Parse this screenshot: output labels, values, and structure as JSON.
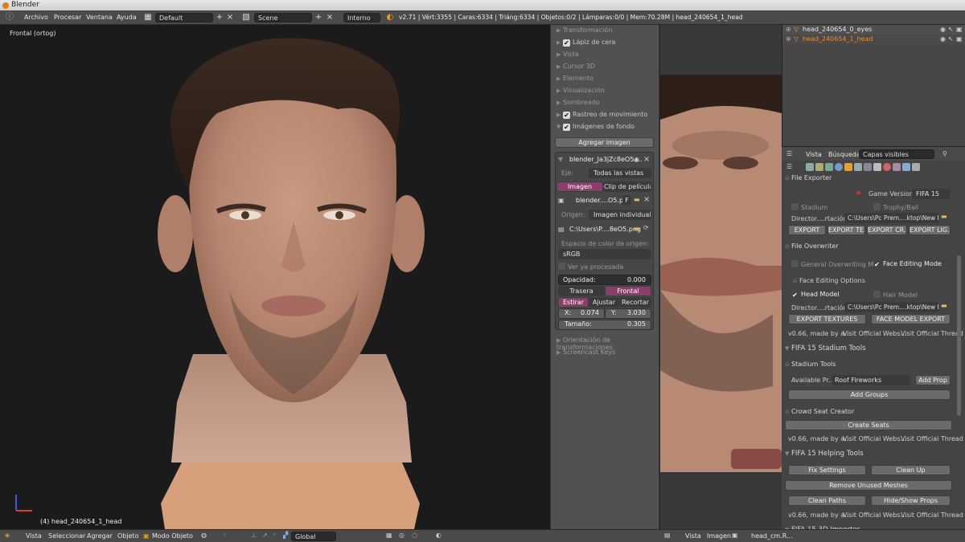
{
  "window": {
    "title": "Blender"
  },
  "menubar": {
    "items": [
      "Archivo",
      "Procesar",
      "Ventana",
      "Ayuda"
    ],
    "layout": "Default",
    "scene": "Scene",
    "engine": "Interno",
    "stats": "v2.71 | Vért:3355 | Caras:6334 | Triáng:6334 | Objetos:0/2 | Lámparas:0/0 | Mem:70.28M | head_240654_1_head"
  },
  "viewport": {
    "view_label": "Frontal (ortog)",
    "object_label": "(4) head_240654_1_head"
  },
  "npanel": {
    "sections": [
      {
        "label": "Transformación",
        "checkbox": false
      },
      {
        "label": "Lápiz de cera",
        "checkbox": true
      },
      {
        "label": "Vista",
        "checkbox": false
      },
      {
        "label": "Cursor 3D",
        "checkbox": false
      },
      {
        "label": "Elemento",
        "checkbox": false
      },
      {
        "label": "Visualización",
        "checkbox": false
      },
      {
        "label": "Sombreado",
        "checkbox": false
      },
      {
        "label": "Rastreo de movimiento",
        "checkbox": true
      },
      {
        "label": "Imágenes de fondo",
        "checkbox": true
      }
    ],
    "add_image": "Agregar imagen",
    "bg_name": "blender_Ja3jZc8eO5....",
    "axis_label": "Eje:",
    "axis_value": "Todas las vistas",
    "tab_image": "Imagen",
    "tab_clip": "Clip de película",
    "image_file": "blender....O5.png",
    "image_flag": "F",
    "origin_label": "Origen:",
    "origin_value": "Imagen individual",
    "path": "C:\\Users\\P....8eO5.png",
    "colorspace_label": "Espacio de color de origen:",
    "colorspace_value": "sRGB",
    "view_processed": "Ver ya procesada",
    "opacity_label": "Opacidad:",
    "opacity_value": "0.000",
    "back": "Trasera",
    "front": "Frontal",
    "stretch": "Estirar",
    "fit": "Ajustar",
    "crop": "Recortar",
    "x_label": "X:",
    "x_value": "0.074",
    "y_label": "Y:",
    "y_value": "3.030",
    "size_label": "Tamaño:",
    "size_value": "0.305",
    "orient": "Orientación de transformaciones",
    "screencast": "Screencast Keys"
  },
  "outliner": {
    "items": [
      {
        "label": "head_240654_0_eyes",
        "active": false
      },
      {
        "label": "head_240654_1_head",
        "active": true
      }
    ]
  },
  "props_header": {
    "view": "Vista",
    "search": "Búsqueda",
    "layers": "Capas visibles"
  },
  "props": {
    "file_exporter": "File Exporter",
    "game_version_label": "Game Version",
    "game_version": "FIFA 15",
    "stadium": "Stadium",
    "trophy": "Trophy/Ball",
    "dir_label": "Director....rtación:",
    "dir_value": "C:\\Users\\Pc Prem....ktop\\New Folder\\",
    "export": "EXPORT",
    "export_tex": "EXPORT TE...",
    "export_cr": "EXPORT CR...",
    "export_lig": "EXPORT LIG...",
    "file_overwriter": "File Overwriter",
    "general_overwriting": "General Overwriting M...",
    "face_editing_mode": "Face Editing Mode",
    "face_editing_options": "Face Editing Options",
    "head_model": "Head Model",
    "hair_model": "Hair Model",
    "dir2_label": "Director....rtación:",
    "dir2_value": "C:\\Users\\Pc Prem....ktop\\New Folder\\",
    "export_textures": "EXPORT TEXTURES",
    "face_model_export": "FACE MODEL EXPORT",
    "made_by": "v0.66, made by a...",
    "visit_webs": "Visit Official Webs...",
    "visit_thread": "Visit Official Thread",
    "stadium_tools": "FIFA 15 Stadium Tools",
    "stadium_tools_sub": "Stadium Tools",
    "available_label": "Available Pr...",
    "available_value": "Roof Fireworks",
    "add_prop": "Add Prop",
    "add_groups": "Add Groups",
    "crowd": "Crowd Seat Creator",
    "create_seats": "Create Seats",
    "helping_tools": "FIFA 15 Helping Tools",
    "fix_settings": "Fix Settings",
    "clean_up": "Clean Up",
    "remove_unused": "Remove Unused Meshes",
    "clean_paths": "Clean Paths",
    "hide_show": "Hide/Show Props",
    "importer": "FIFA 15 3D Importer"
  },
  "statusbar": {
    "left": [
      "Vista",
      "Seleccionar",
      "Agregar",
      "Objeto"
    ],
    "mode": "Modo Objeto",
    "orientation": "Global",
    "right": [
      "Vista",
      "Imagen"
    ],
    "image_name": "head_cm.R..."
  }
}
